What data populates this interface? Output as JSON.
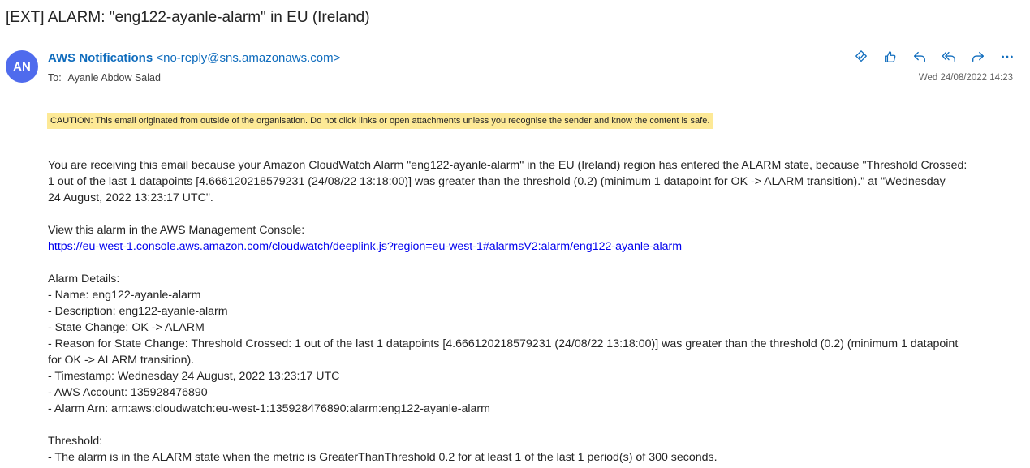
{
  "email": {
    "subject": "[EXT] ALARM: \"eng122-ayanle-alarm\" in EU (Ireland)",
    "avatar_initials": "AN",
    "sender_name": "AWS Notifications",
    "sender_email": "<no-reply@sns.amazonaws.com>",
    "to_label": "To:",
    "to_name": "Ayanle Abdow Salad",
    "date": "Wed 24/08/2022 14:23",
    "caution": "CAUTION: This email originated from outside of the organisation. Do not click links or open attachments unless you recognise the sender and know the content is safe.",
    "intro_line1": "You are receiving this email because your Amazon CloudWatch Alarm \"eng122-ayanle-alarm\" in the EU (Ireland) region has entered the ALARM state, because \"Threshold Crossed:",
    "intro_line2": "1 out of the last 1 datapoints [4.666120218579231 (24/08/22 13:18:00)] was greater than the threshold (0.2) (minimum 1 datapoint for OK -> ALARM transition).\" at \"Wednesday",
    "intro_line3": "24 August, 2022 13:23:17 UTC\".",
    "console_label": "View this alarm in the AWS Management Console:",
    "console_link": "https://eu-west-1.console.aws.amazon.com/cloudwatch/deeplink.js?region=eu-west-1#alarmsV2:alarm/eng122-ayanle-alarm",
    "details_header": "Alarm Details:",
    "detail_name": "- Name: eng122-ayanle-alarm",
    "detail_description": "- Description: eng122-ayanle-alarm",
    "detail_state_change": "- State Change: OK -> ALARM",
    "detail_reason_line1": "- Reason for State Change: Threshold Crossed: 1 out of the last 1 datapoints [4.666120218579231 (24/08/22 13:18:00)] was greater than the threshold (0.2) (minimum 1 datapoint",
    "detail_reason_line2": "for OK -> ALARM transition).",
    "detail_timestamp": "- Timestamp: Wednesday 24 August, 2022 13:23:17 UTC",
    "detail_account": "- AWS Account: 135928476890",
    "detail_arn": "- Alarm Arn: arn:aws:cloudwatch:eu-west-1:135928476890:alarm:eng122-ayanle-alarm",
    "threshold_header": "Threshold:",
    "threshold_line": "- The alarm is in the ALARM state when the metric is GreaterThanThreshold 0.2 for at least 1 of the last 1 period(s) of 300 seconds."
  },
  "icons": {
    "accent": "#0f6cbd",
    "actions": [
      "open-in-app-icon",
      "like-icon",
      "reply-icon",
      "reply-all-icon",
      "forward-icon",
      "more-icon"
    ]
  }
}
